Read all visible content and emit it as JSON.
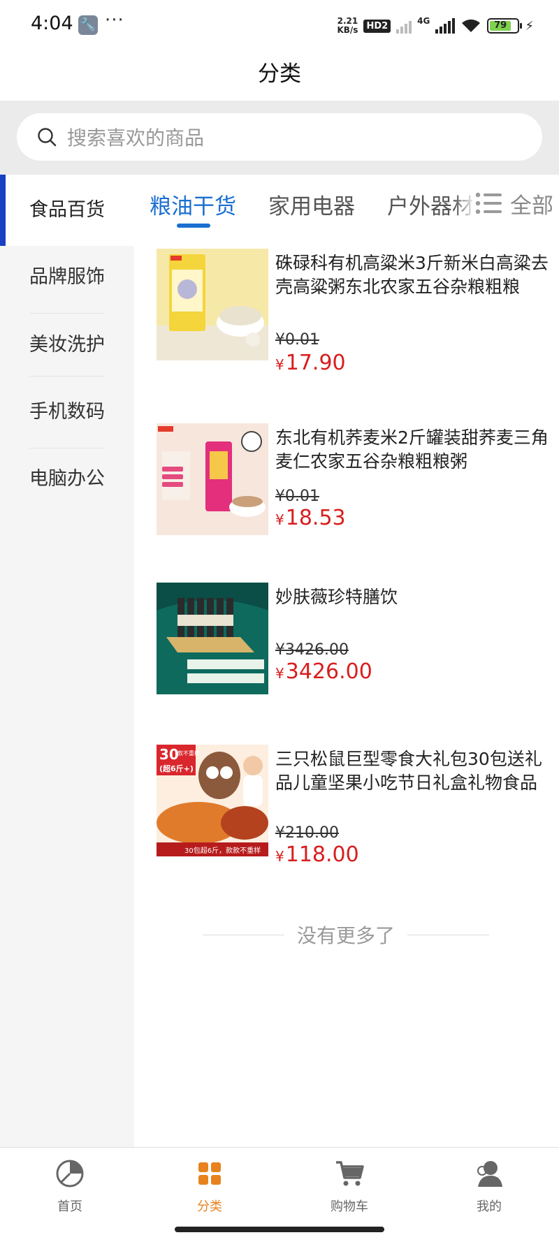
{
  "status_bar": {
    "time": "4:04",
    "speed_top": "2.21",
    "speed_unit": "KB/s",
    "hd": "HD2",
    "network": "4G",
    "battery": "79"
  },
  "header": {
    "title": "分类"
  },
  "search": {
    "placeholder": "搜索喜欢的商品"
  },
  "sidebar": {
    "items": [
      {
        "label": "食品百货",
        "active": true
      },
      {
        "label": "品牌服饰"
      },
      {
        "label": "美妆洗护"
      },
      {
        "label": "手机数码"
      },
      {
        "label": "电脑办公"
      }
    ]
  },
  "tabs": {
    "items": [
      {
        "label": "粮油干货",
        "active": true
      },
      {
        "label": "家用电器"
      },
      {
        "label": "户外器材"
      }
    ],
    "all_label": "全部"
  },
  "products": [
    {
      "name": "硃碌科有机高粱米3斤新米白高粱去壳高粱粥东北农家五谷杂粮粗粮",
      "old_price": "¥0.01",
      "currency": "¥",
      "price": "17.90"
    },
    {
      "name": "东北有机荞麦米2斤罐装甜荞麦三角麦仁农家五谷杂粮粗粮粥",
      "old_price": "¥0.01",
      "currency": "¥",
      "price": "18.53"
    },
    {
      "name": "妙肤薇珍特膳饮",
      "old_price": "¥3426.00",
      "currency": "¥",
      "price": "3426.00"
    },
    {
      "name": "三只松鼠巨型零食大礼包30包送礼品儿童坚果小吃节日礼盒礼物食品",
      "old_price": "¥210.00",
      "currency": "¥",
      "price": "118.00"
    }
  ],
  "thumb_text": {
    "p4_badge_top": "30",
    "p4_badge_sub": "款不重样",
    "p4_badge_weight": "(超6斤+)",
    "p4_caption": "30包超6斤，款款不重样"
  },
  "list_end": {
    "text": "没有更多了"
  },
  "bottom_nav": {
    "items": [
      {
        "label": "首页",
        "icon": "pie-chart-icon"
      },
      {
        "label": "分类",
        "icon": "grid-icon",
        "active": true
      },
      {
        "label": "购物车",
        "icon": "cart-icon"
      },
      {
        "label": "我的",
        "icon": "user-icon"
      }
    ]
  },
  "colors": {
    "accent_blue": "#1a6fd1",
    "sidebar_active_bar": "#1a3fc2",
    "price_red": "#d81e1e",
    "nav_active": "#e8821f"
  }
}
